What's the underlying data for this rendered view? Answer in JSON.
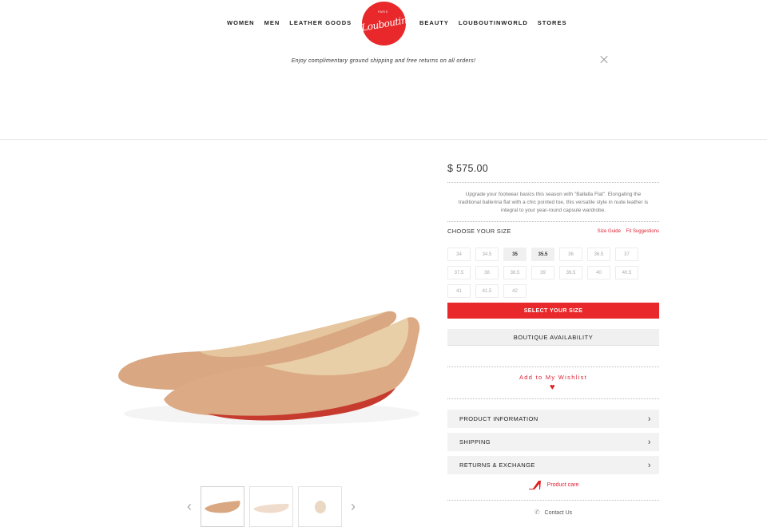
{
  "nav": {
    "left": [
      "WOMEN",
      "MEN",
      "LEATHER GOODS"
    ],
    "right": [
      "BEAUTY",
      "LOUBOUTINWORLD",
      "STORES"
    ],
    "logo_text": "Louboutin",
    "logo_small": "PARIS"
  },
  "promo": {
    "text": "Enjoy complimentary ground shipping and free returns on all orders!"
  },
  "product": {
    "price": "$ 575.00",
    "description": "Upgrade your footwear basics this season with \"Ballalla Flat\". Elongating the traditional ballerina flat with a chic pointed toe, this versatile style in nude leather is integral to your year-round capsule wardrobe.",
    "size_title": "CHOOSE YOUR SIZE",
    "size_guide": "Size Guide",
    "fit_suggestions": "Fit Suggestions",
    "sizes": [
      "34",
      "34.5",
      "35",
      "35.5",
      "36",
      "36.5",
      "37",
      "37.5",
      "38",
      "38.5",
      "39",
      "39.5",
      "40",
      "40.5",
      "41",
      "41.5",
      "42"
    ],
    "available_sizes": [
      "35",
      "35.5"
    ],
    "select_size": "SELECT YOUR SIZE",
    "boutique": "BOUTIQUE AVAILABILITY",
    "wishlist": "Add to My Wishlist",
    "accordion": [
      "PRODUCT INFORMATION",
      "SHIPPING",
      "RETURNS & EXCHANGE"
    ],
    "care": "Product care",
    "contact": "Contact Us"
  },
  "colors": {
    "brand_red": "#e8282b",
    "leather": "#d9a882"
  }
}
